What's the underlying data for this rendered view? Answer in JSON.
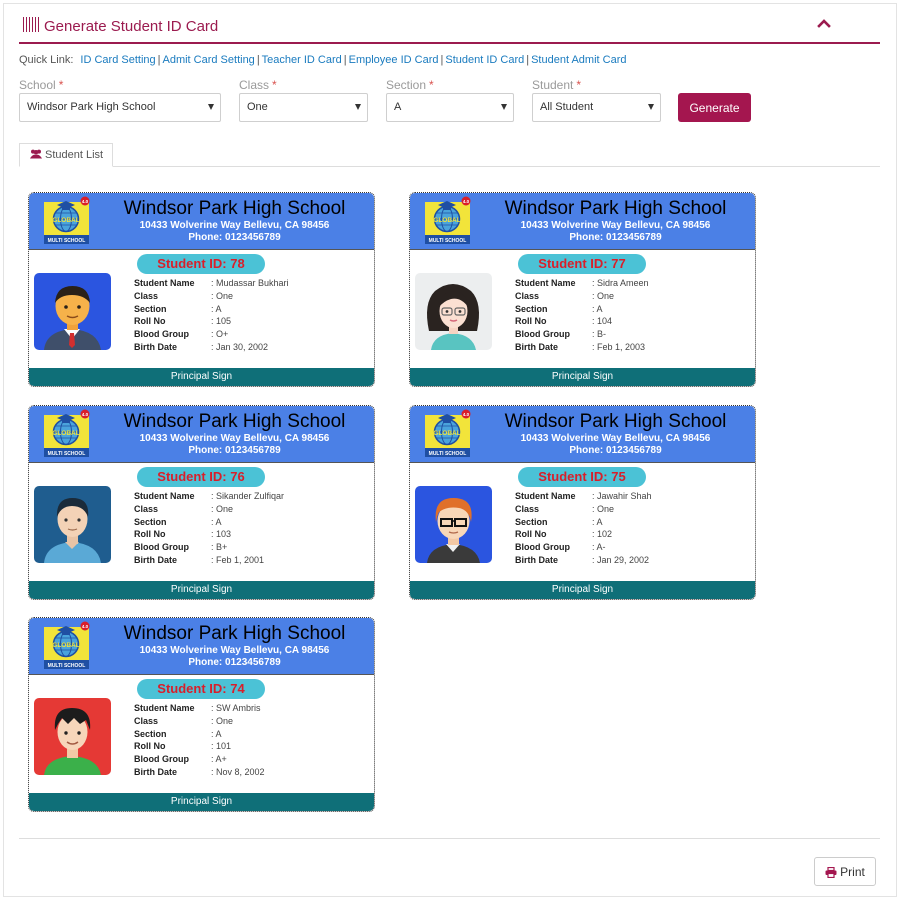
{
  "panel": {
    "title": "Generate Student ID Card"
  },
  "quick_links": {
    "label": "Quick Link:",
    "items": [
      "ID Card Setting",
      "Admit Card Setting",
      "Teacher ID Card",
      "Employee ID Card",
      "Student ID Card",
      "Student Admit Card"
    ],
    "separator": "|"
  },
  "filters": {
    "required_mark": "*",
    "school": {
      "label": "School",
      "value": "Windsor Park High School"
    },
    "class": {
      "label": "Class",
      "value": "One"
    },
    "section": {
      "label": "Section",
      "value": "A"
    },
    "student": {
      "label": "Student",
      "value": "All Student"
    },
    "generate_label": "Generate"
  },
  "tab": {
    "label": "Student List"
  },
  "card_template": {
    "school_name": "Windsor Park High School",
    "address": "10433 Wolverine Way Bellevu, CA 98456",
    "phone": "Phone: 0123456789",
    "logo_text_top": "GLOBAL",
    "logo_text_bottom": "MULTI SCHOOL",
    "logo_badge": "4.0",
    "footer": "Principal Sign",
    "field_labels": {
      "name": "Student Name",
      "class": "Class",
      "section": "Section",
      "roll": "Roll No",
      "blood": "Blood Group",
      "birth": "Birth Date"
    }
  },
  "cards": [
    {
      "student_id": "Student ID: 78",
      "name": ": Mudassar Bukhari",
      "class": ": One",
      "section": ": A",
      "roll": ": 105",
      "blood": ": O+",
      "birth": ": Jan 30, 2002",
      "avatar": "male-suit-avatar"
    },
    {
      "student_id": "Student ID: 77",
      "name": ": Sidra Ameen",
      "class": ": One",
      "section": ": A",
      "roll": ": 104",
      "blood": ": B-",
      "birth": ": Feb 1, 2003",
      "avatar": "female-glasses-avatar"
    },
    {
      "student_id": "Student ID: 76",
      "name": ": Sikander Zulfiqar",
      "class": ": One",
      "section": ": A",
      "roll": ": 103",
      "blood": ": B+",
      "birth": ": Feb 1, 2001",
      "avatar": "male-shirt-avatar"
    },
    {
      "student_id": "Student ID: 75",
      "name": ": Jawahir Shah",
      "class": ": One",
      "section": ": A",
      "roll": ": 102",
      "blood": ": A-",
      "birth": ": Jan 29, 2002",
      "avatar": "male-glasses-avatar"
    },
    {
      "student_id": "Student ID: 74",
      "name": ": SW Ambris",
      "class": ": One",
      "section": ": A",
      "roll": ": 101",
      "blood": ": A+",
      "birth": ": Nov 8, 2002",
      "avatar": "boy-green-shirt-avatar"
    }
  ],
  "print": {
    "label": "Print"
  },
  "colors": {
    "brand": "#9b1b4f",
    "card_header": "#4b80e6",
    "card_footer": "#0f6f78",
    "id_pill": "#4bc2d6",
    "id_text": "#d91f2a",
    "link": "#1a7bbf"
  }
}
